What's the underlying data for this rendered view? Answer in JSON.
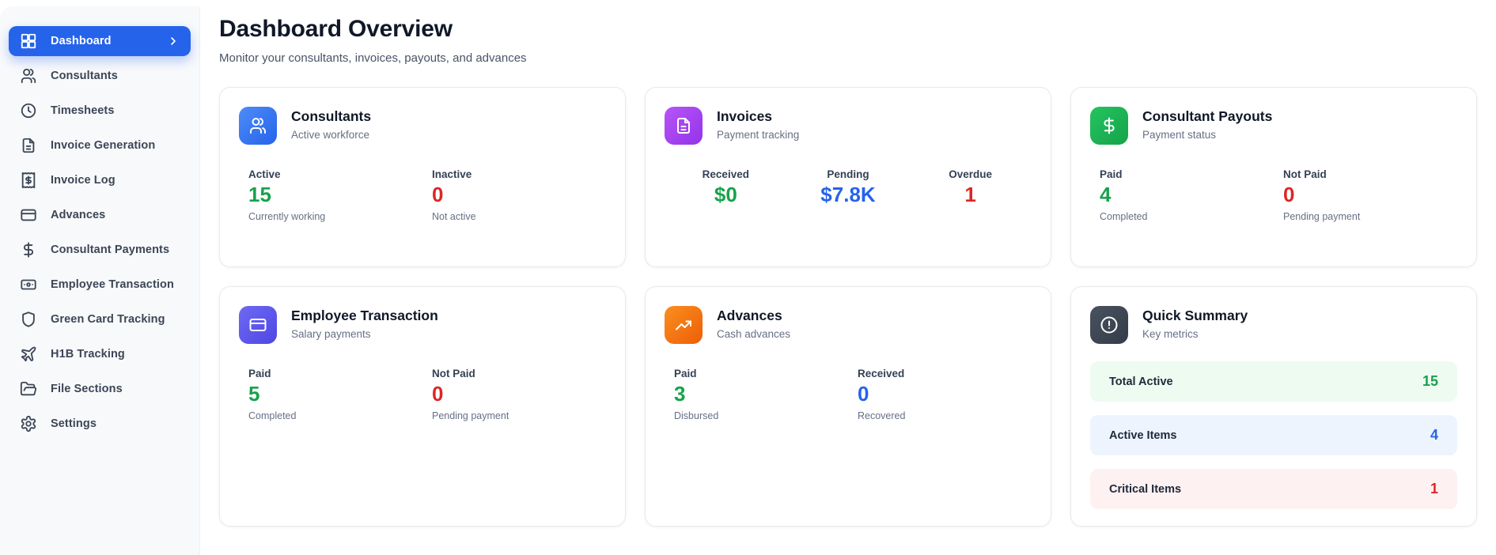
{
  "page": {
    "title": "Dashboard Overview",
    "subtitle": "Monitor your consultants, invoices, payouts, and advances"
  },
  "sidebar": {
    "items": [
      {
        "label": "Dashboard",
        "icon": "dashboard-icon",
        "active": true
      },
      {
        "label": "Consultants",
        "icon": "users-icon"
      },
      {
        "label": "Timesheets",
        "icon": "clock-icon"
      },
      {
        "label": "Invoice Generation",
        "icon": "file-text-icon"
      },
      {
        "label": "Invoice Log",
        "icon": "receipt-icon"
      },
      {
        "label": "Advances",
        "icon": "credit-card-icon"
      },
      {
        "label": "Consultant Payments",
        "icon": "dollar-icon"
      },
      {
        "label": "Employee Transaction",
        "icon": "banknote-icon"
      },
      {
        "label": "Green Card Tracking",
        "icon": "shield-icon"
      },
      {
        "label": "H1B Tracking",
        "icon": "plane-icon"
      },
      {
        "label": "File Sections",
        "icon": "folder-open-icon"
      },
      {
        "label": "Settings",
        "icon": "gear-icon"
      }
    ]
  },
  "cards": [
    {
      "id": "consultants",
      "title": "Consultants",
      "subtitle": "Active workforce",
      "icon": "users-icon",
      "icon_color": "blue",
      "stats": [
        {
          "label": "Active",
          "value": "15",
          "color": "green",
          "sub": "Currently working"
        },
        {
          "label": "Inactive",
          "value": "0",
          "color": "red",
          "sub": "Not active"
        }
      ]
    },
    {
      "id": "invoices",
      "title": "Invoices",
      "subtitle": "Payment tracking",
      "icon": "file-text-icon",
      "icon_color": "purple",
      "centered": true,
      "stats": [
        {
          "label": "Received",
          "value": "$0",
          "color": "green"
        },
        {
          "label": "Pending",
          "value": "$7.8K",
          "color": "blue"
        },
        {
          "label": "Overdue",
          "value": "1",
          "color": "red"
        }
      ]
    },
    {
      "id": "consultant-payouts",
      "title": "Consultant Payouts",
      "subtitle": "Payment status",
      "icon": "dollar-icon",
      "icon_color": "green",
      "stats": [
        {
          "label": "Paid",
          "value": "4",
          "color": "green",
          "sub": "Completed"
        },
        {
          "label": "Not Paid",
          "value": "0",
          "color": "red",
          "sub": "Pending payment"
        }
      ]
    },
    {
      "id": "employee-transaction",
      "title": "Employee Transaction",
      "subtitle": "Salary payments",
      "icon": "credit-card-icon",
      "icon_color": "indigo",
      "stats": [
        {
          "label": "Paid",
          "value": "5",
          "color": "green",
          "sub": "Completed"
        },
        {
          "label": "Not Paid",
          "value": "0",
          "color": "red",
          "sub": "Pending payment"
        }
      ]
    },
    {
      "id": "advances",
      "title": "Advances",
      "subtitle": "Cash advances",
      "icon": "trending-up-icon",
      "icon_color": "orange",
      "stats": [
        {
          "label": "Paid",
          "value": "3",
          "color": "green",
          "sub": "Disbursed"
        },
        {
          "label": "Received",
          "value": "0",
          "color": "blue",
          "sub": "Recovered"
        }
      ]
    },
    {
      "id": "quick-summary",
      "title": "Quick Summary",
      "subtitle": "Key metrics",
      "icon": "alert-circle-icon",
      "icon_color": "dark",
      "summary_rows": [
        {
          "label": "Total Active",
          "value": "15",
          "color": "green"
        },
        {
          "label": "Active Items",
          "value": "4",
          "color": "blue"
        },
        {
          "label": "Critical Items",
          "value": "1",
          "color": "red"
        }
      ]
    }
  ],
  "colors": {
    "accent_blue": "#2563eb",
    "green": "#16a34a",
    "red": "#dc2626",
    "blue": "#2563eb",
    "purple": "#9333ea",
    "indigo": "#4f46e5",
    "orange": "#ee5e07",
    "dark": "#333c48",
    "sidebar_bg": "#f8f9fb",
    "summary_green_bg": "#eefbf1",
    "summary_blue_bg": "#edf4fe",
    "summary_red_bg": "#fdf1f1"
  }
}
